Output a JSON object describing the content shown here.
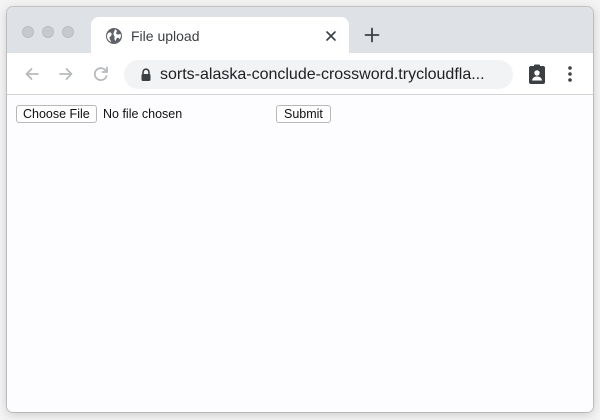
{
  "browser": {
    "tab": {
      "title": "File upload",
      "favicon": "globe-icon"
    },
    "new_tab_icon": "plus-icon",
    "close_tab_icon": "close-icon",
    "address_bar": {
      "url": "sorts-alaska-conclude-crossword.trycloudfla...",
      "lock_icon": "lock-icon"
    },
    "nav": {
      "back_icon": "back-arrow-icon",
      "forward_icon": "forward-arrow-icon",
      "reload_icon": "reload-icon"
    },
    "toolbar_icons": [
      "profile-icon",
      "kebab-menu-icon"
    ],
    "colors": {
      "tab_strip": "#dee1e6",
      "omnibox": "#f1f3f4",
      "page_background": "#fdfcfe"
    }
  },
  "page": {
    "file_input": {
      "button_label": "Choose File",
      "status": "No file chosen"
    },
    "submit_label": "Submit"
  }
}
